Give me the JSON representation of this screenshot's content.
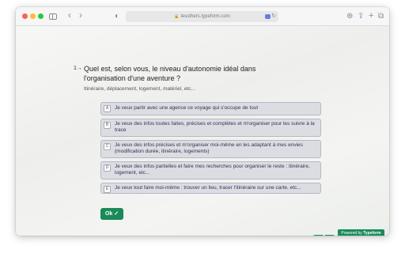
{
  "browser": {
    "url": "lesothers.typeform.com",
    "lock_icon": "🔒",
    "reload_icon": "↻",
    "back_icon": "‹",
    "forward_icon": "›",
    "shield_icon": "◐",
    "download_icon": "⊕",
    "share_icon": "⇪",
    "new_tab_icon": "+",
    "tabs_icon": "⧉"
  },
  "question": {
    "number_marker": "1→",
    "title": "Quel est, selon vous, le niveau d'autonomie idéal dans l'organisation d'une aventure ?",
    "description": "Itinéraire, déplacement, logement, matériel, etc..."
  },
  "options": [
    {
      "key": "A",
      "text": "Je veux partir avec une agence ce voyage qui s'occupe de tout"
    },
    {
      "key": "B",
      "text": "Je veux des infos toutes faites, précises et complètes et m'organiser pour les suivre à la trace"
    },
    {
      "key": "C",
      "text": "Je veux des infos précises et m'organiser moi-même en les adaptant à mes envies (modification durée, itinéraire, logements)"
    },
    {
      "key": "D",
      "text": "Je veux des infos partielles et faire mes recherches pour organiser le reste : itinéraire, logement, etc..."
    },
    {
      "key": "E",
      "text": "Je veux tout faire moi-même : trouver un lieu, tracer l'itinéraire sur une carte, etc..."
    }
  ],
  "ok_button": {
    "label": "Ok ✓"
  },
  "nav": {
    "up": "▲",
    "down": "▼"
  },
  "powered_by": {
    "prefix": "Powered by ",
    "brand": "Typeform"
  },
  "colors": {
    "accent": "#1a8a5a",
    "option_bg": "#dcdde3",
    "option_border": "#b6b7c1"
  }
}
